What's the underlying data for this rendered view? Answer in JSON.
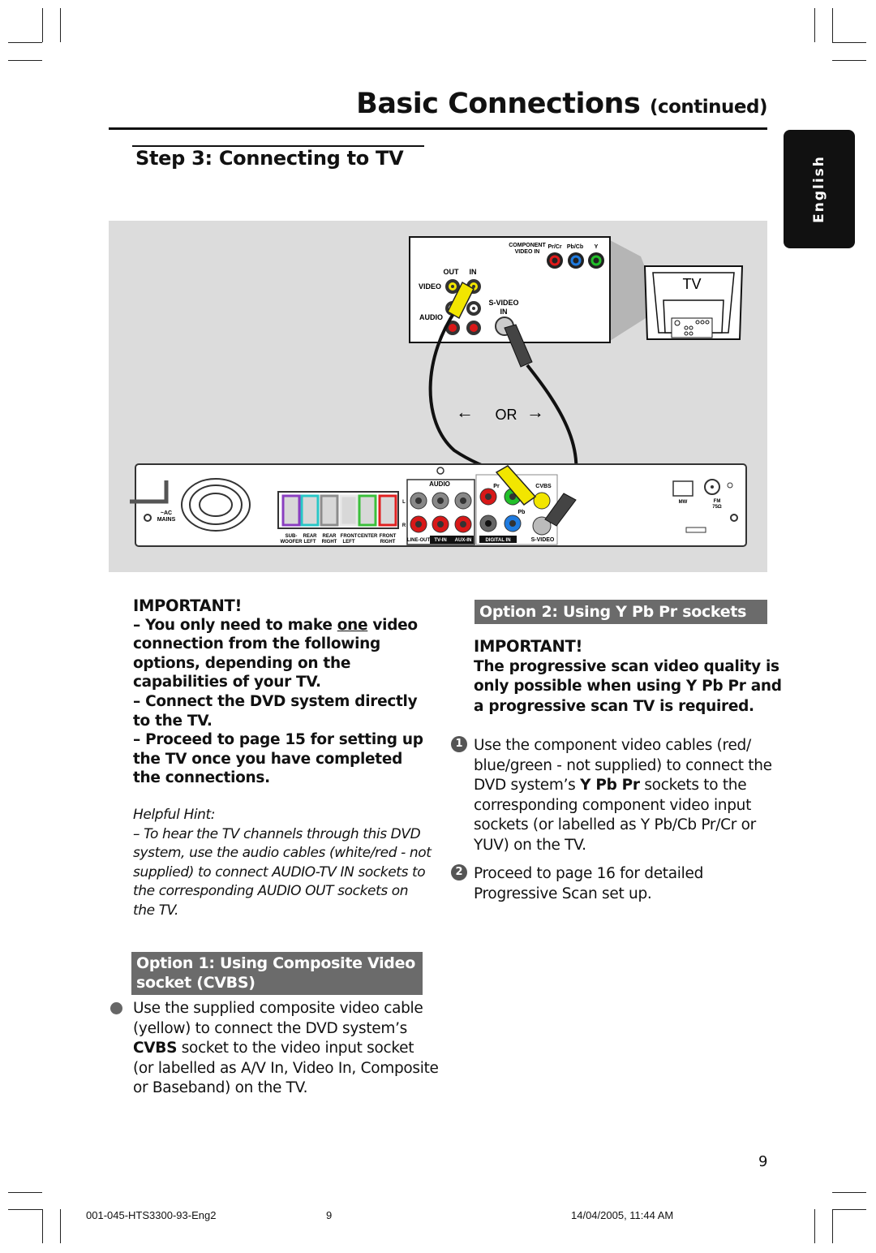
{
  "header": {
    "title": "Basic Connections",
    "title_suffix": "(continued)"
  },
  "step": {
    "title": "Step 3:  Connecting to TV"
  },
  "language_tab": "English",
  "diagram": {
    "tv_panel": {
      "component_label_1": "COMPONENT",
      "component_label_2": "VIDEO IN",
      "pr_cr": "Pr/Cr",
      "pb_cb": "Pb/Cb",
      "y": "Y",
      "out": "OUT",
      "in": "IN",
      "video": "VIDEO",
      "audio": "AUDIO",
      "svideo_1": "S-VIDEO",
      "svideo_2": "IN"
    },
    "tv_label": "TV",
    "or_label": "OR",
    "device": {
      "ac_mains_1": "~AC",
      "ac_mains_2": "MAINS",
      "speakers": [
        {
          "l1": "SUB-",
          "l2": "WOOFER",
          "color": "#8a3fc0"
        },
        {
          "l1": "REAR",
          "l2": "LEFT",
          "color": "#28c6c6"
        },
        {
          "l1": "REAR",
          "l2": "RIGHT",
          "color": "#8c8c8c"
        },
        {
          "l1": "FRONT",
          "l2": "LEFT",
          "color": "#e8e8e8"
        },
        {
          "l1": "CENTER",
          "l2": "",
          "color": "#3bbf3b"
        },
        {
          "l1": "FRONT",
          "l2": "RIGHT",
          "color": "#e02020"
        }
      ],
      "audio": "AUDIO",
      "l": "L",
      "r": "R",
      "line_out": "LINE-OUT",
      "tv_in": "TV-IN",
      "aux_in": "AUX-IN",
      "pr": "Pr",
      "pb": "Pb",
      "digital_in": "DIGITAL IN",
      "cvbs": "CVBS",
      "svideo": "S-VIDEO",
      "mw": "MW",
      "fm": "FM",
      "fm_ohm": "75Ω"
    }
  },
  "left": {
    "important_title": "IMPORTANT!",
    "important_lines": [
      [
        {
          "t": "–  You only need to make "
        },
        {
          "t": "one",
          "u": true
        },
        {
          "t": " video"
        }
      ],
      [
        {
          "t": "connection from the following"
        }
      ],
      [
        {
          "t": "options, depending on the"
        }
      ],
      [
        {
          "t": "capabilities of your TV."
        }
      ],
      [
        {
          "t": "–  Connect the DVD system directly"
        }
      ],
      [
        {
          "t": "to the TV."
        }
      ],
      [
        {
          "t": "–  Proceed to page 15 for setting up"
        }
      ],
      [
        {
          "t": "the TV once you have completed"
        }
      ],
      [
        {
          "t": "the connections."
        }
      ]
    ],
    "hint_title": "Helpful Hint:",
    "hint_lines": [
      [
        {
          "t": "–  To hear the TV channels through this DVD"
        }
      ],
      [
        {
          "t": "system, use the audio cables (white/red - not"
        }
      ],
      [
        {
          "t": "supplied) to connect AUDIO-TV IN sockets to"
        }
      ],
      [
        {
          "t": "the corresponding AUDIO OUT sockets on"
        }
      ],
      [
        {
          "t": "the TV."
        }
      ]
    ],
    "option1_lines": [
      "Option 1: Using Composite Video",
      "socket (CVBS)"
    ],
    "option1_body": [
      [
        {
          "t": "Use the supplied composite video cable"
        }
      ],
      [
        {
          "t": "(yellow) to connect the DVD system’s"
        }
      ],
      [
        {
          "t": "CVBS",
          "b": true
        },
        {
          "t": " socket to the video input socket"
        }
      ],
      [
        {
          "t": "(or labelled as A/V In, Video In, Composite"
        }
      ],
      [
        {
          "t": "or Baseband) on the TV."
        }
      ]
    ]
  },
  "right": {
    "option2_title": "Option 2: Using Y Pb Pr sockets",
    "important_title": "IMPORTANT!",
    "important_lines": [
      [
        {
          "t": "The progressive scan video quality is"
        }
      ],
      [
        {
          "t": "only possible when using Y Pb Pr and"
        }
      ],
      [
        {
          "t": "a progressive scan TV is required."
        }
      ]
    ],
    "steps": [
      {
        "num": "1",
        "lines": [
          [
            {
              "t": "Use the component video cables (red/"
            }
          ],
          [
            {
              "t": "blue/green - not supplied) to connect the"
            }
          ],
          [
            {
              "t": "DVD system’s "
            },
            {
              "t": "Y Pb Pr",
              "b": true
            },
            {
              "t": " sockets to the"
            }
          ],
          [
            {
              "t": "corresponding component video input"
            }
          ],
          [
            {
              "t": "sockets (or labelled as Y Pb/Cb Pr/Cr or"
            }
          ],
          [
            {
              "t": "YUV) on the TV."
            }
          ]
        ]
      },
      {
        "num": "2",
        "lines": [
          [
            {
              "t": "Proceed to page 16 for detailed"
            }
          ],
          [
            {
              "t": "Progressive Scan set up."
            }
          ]
        ]
      }
    ]
  },
  "page_number": "9",
  "footer": {
    "file": "001-045-HTS3300-93-Eng2",
    "page": "9",
    "datetime": "14/04/2005, 11:44 AM"
  }
}
